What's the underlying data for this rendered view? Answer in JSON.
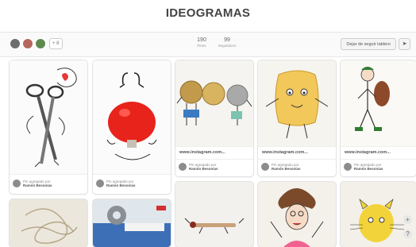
{
  "board": {
    "title": "IDEOGRAMAS",
    "collaborators_more": "+ 8",
    "pins_count": "190",
    "pins_label": "Pines",
    "followers_count": "99",
    "followers_label": "Seguidores",
    "unfollow_label": "Dejar de seguir tablero",
    "send_icon": "paper-plane-icon"
  },
  "pins": [
    {
      "source": "",
      "credit_prefix": "Pin agregado por",
      "credit_name": "Ramón Besonías",
      "image": "scissors-figure"
    },
    {
      "source": "",
      "credit_prefix": "Pin agregado por",
      "credit_name": "Ramón Besonías",
      "image": "red-nose-face"
    },
    {
      "source": "www.instagram.com...",
      "credit_prefix": "Pin agregado por",
      "credit_name": "Ramón Besonías",
      "image": "coins-figures"
    },
    {
      "source": "www.instagram.com...",
      "credit_prefix": "Pin agregado por",
      "credit_name": "Ramón Besonías",
      "image": "sponge-figure"
    },
    {
      "source": "www.instagram.com...",
      "credit_prefix": "Pin agregado por",
      "credit_name": "Ramón Besonías",
      "image": "hiker-figure"
    }
  ],
  "fab_icons": [
    "plus-icon",
    "help-icon"
  ],
  "fab_labels": [
    "+",
    "?"
  ]
}
